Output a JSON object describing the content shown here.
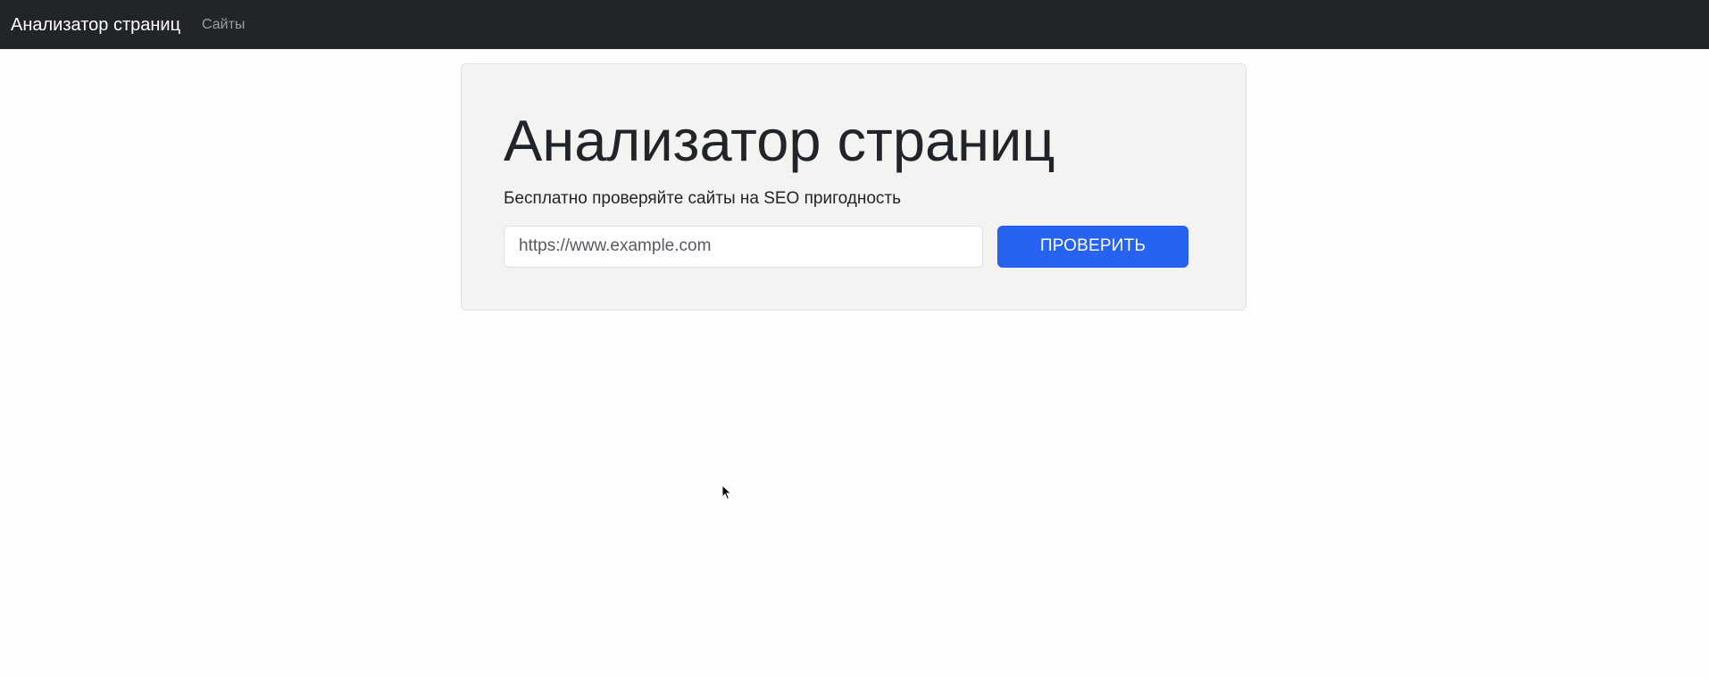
{
  "navbar": {
    "brand": "Анализатор страниц",
    "links": [
      {
        "label": "Сайты"
      }
    ],
    "background_color": "#212529"
  },
  "hero": {
    "title": "Анализатор страниц",
    "subtitle": "Бесплатно проверяйте сайты на SEO пригодность",
    "url_input": {
      "placeholder": "https://www.example.com",
      "value": ""
    },
    "submit_label": "ПРОВЕРИТЬ",
    "accent_color": "#2563f0"
  },
  "icons": {
    "cursor": "mouse-pointer-icon"
  }
}
